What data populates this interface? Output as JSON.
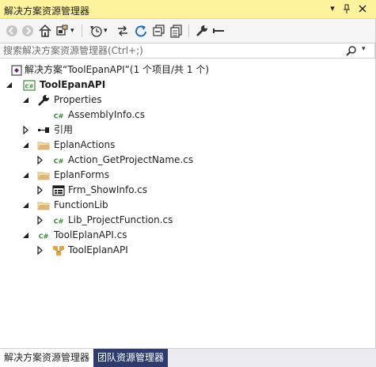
{
  "window": {
    "title": "解决方案资源管理器",
    "buttons": [
      "▾",
      "📌",
      "✕"
    ]
  },
  "search": {
    "placeholder": "搜索解决方案资源管理器(Ctrl+;)"
  },
  "tree": {
    "solution": "解决方案“ToolEpanAPI”(1 个项目/共 1 个)",
    "project": "ToolEpanAPI",
    "properties": "Properties",
    "assemblyinfo": "AssemblyInfo.cs",
    "references": "引用",
    "eplanactions": "EplanActions",
    "action_getprojectname": "Action_GetProjectName.cs",
    "eplanforms": "EplanForms",
    "frm_showinfo": "Frm_ShowInfo.cs",
    "functionlib": "FunctionLib",
    "lib_projectfunction": "Lib_ProjectFunction.cs",
    "tooleplanapi_cs": "ToolEplanAPI.cs",
    "tooleplanapi_class": "ToolEplanAPI"
  },
  "tabs": {
    "solution_explorer": "解决方案资源管理器",
    "team_explorer": "团队资源管理器"
  },
  "colors": {
    "title_bg": "#fff29d",
    "csharp_green": "#388a34",
    "folder": "#dcb67a",
    "tab_inactive_bg": "#2d3c6c"
  }
}
